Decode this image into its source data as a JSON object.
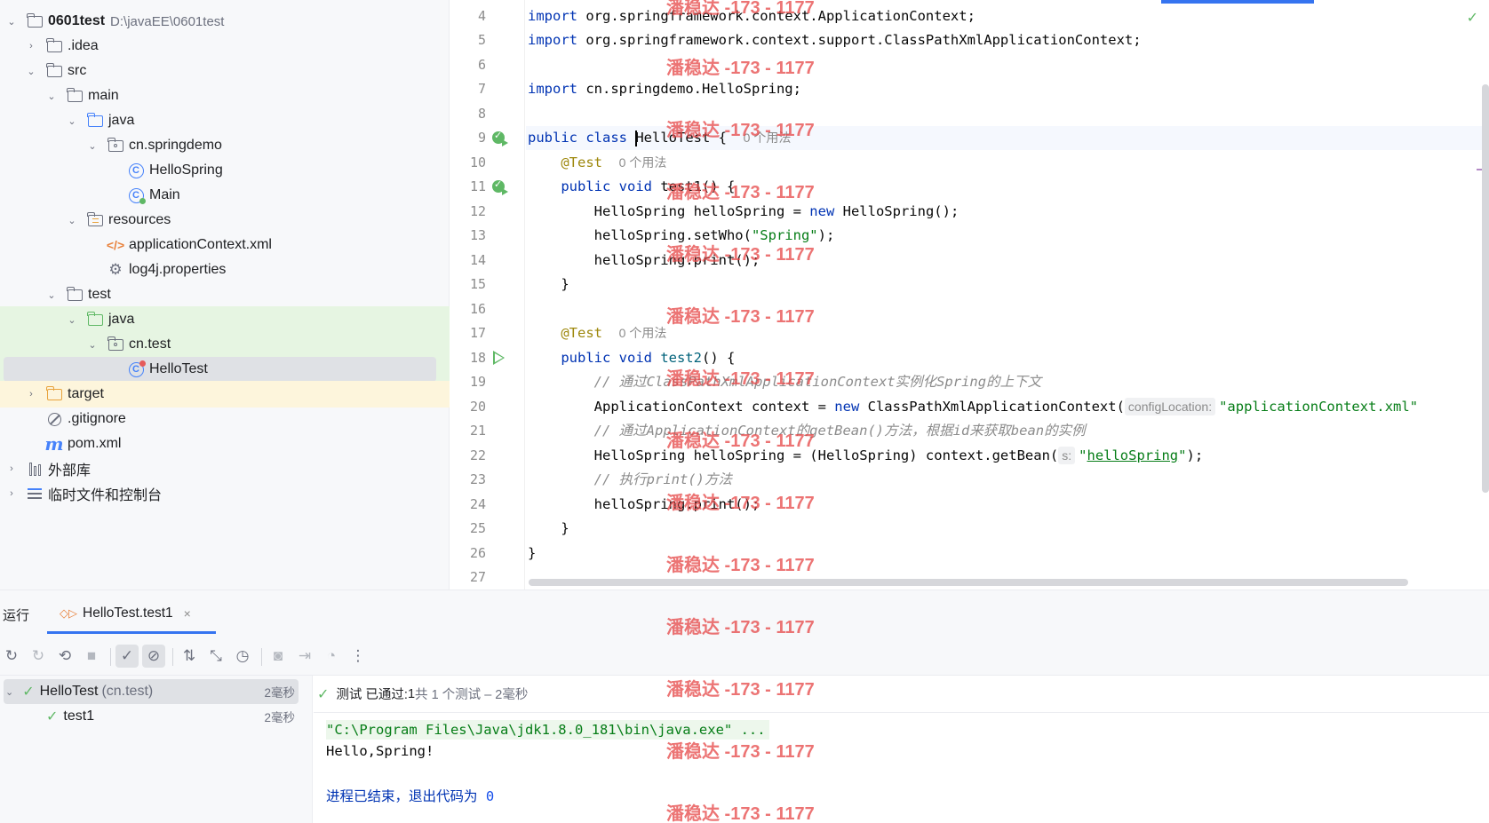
{
  "project_tree": {
    "items": [
      {
        "label": "0601test",
        "path": "D:\\javaEE\\0601test"
      },
      {
        "label": ".idea"
      },
      {
        "label": "src"
      },
      {
        "label": "main"
      },
      {
        "label": "java"
      },
      {
        "label": "cn.springdemo"
      },
      {
        "label": "HelloSpring"
      },
      {
        "label": "Main"
      },
      {
        "label": "resources"
      },
      {
        "label": "applicationContext.xml"
      },
      {
        "label": "log4j.properties"
      },
      {
        "label": "test"
      },
      {
        "label": "java"
      },
      {
        "label": "cn.test"
      },
      {
        "label": "HelloTest"
      },
      {
        "label": "target"
      },
      {
        "label": ".gitignore"
      },
      {
        "label": "pom.xml"
      },
      {
        "label": "外部库"
      },
      {
        "label": "临时文件和控制台"
      }
    ]
  },
  "editor": {
    "line_numbers": [
      "4",
      "5",
      "6",
      "7",
      "8",
      "9",
      "10",
      "11",
      "12",
      "13",
      "14",
      "15",
      "16",
      "17",
      "18",
      "19",
      "20",
      "21",
      "22",
      "23",
      "24",
      "25",
      "26",
      "27"
    ],
    "usage_hint": "0 个用法",
    "param_hint_config": "configLocation:",
    "param_hint_s": "s:",
    "code": {
      "l4_import": "import",
      "l4_rest": " org.springframework.context.ApplicationContext;",
      "l5_import": "import",
      "l5_rest": " org.springframework.context.support.ClassPathXmlApplicationContext;",
      "l7_import": "import",
      "l7_rest": " cn.springdemo.HelloSpring;",
      "l9_kw": "public class ",
      "l9_name": "HelloTest",
      "l9_rest": " {  ",
      "l10_ann": "@Test",
      "l11_kw": "public void ",
      "l11_rest": "test1() {",
      "l12_a": "HelloSpring helloSpring = ",
      "l12_kw": "new",
      "l12_b": " HelloSpring();",
      "l13_a": "helloSpring.setWho(",
      "l13_str": "\"Spring\"",
      "l13_b": ");",
      "l14": "helloSpring.print();",
      "l15": "}",
      "l17_ann": "@Test",
      "l18_kw": "public void ",
      "l18_meth": "test2",
      "l18_rest": "() {",
      "l19_cmt": "// 通过ClassPathXmlApplicationContext实例化Spring的上下文",
      "l20_a": "ApplicationContext context = ",
      "l20_kw": "new",
      "l20_b": " ClassPathXmlApplicationContext(",
      "l20_str": "\"applicationContext.xml\"",
      "l21_cmt": "// 通过ApplicationContext的getBean()方法，根据id来获取bean的实例",
      "l22_a": "HelloSpring helloSpring = (HelloSpring) context.getBean(",
      "l22_q1": "\"",
      "l22_str": "helloSpring",
      "l22_q2": "\"",
      "l22_b": ");",
      "l23_cmt": "// 执行print()方法",
      "l24": "helloSpring.print();",
      "l25": "}",
      "l26": "}"
    }
  },
  "run_panel": {
    "title": "运行",
    "tab_label": "HelloTest.test1",
    "tab_close": "×",
    "status_text": "测试 已通过: ",
    "status_count": "1",
    "status_detail": "共 1 个测试 – 2毫秒",
    "test_tree": [
      {
        "label": "HelloTest",
        "pkg": "(cn.test)",
        "time": "2毫秒"
      },
      {
        "label": "test1",
        "time": "2毫秒"
      }
    ],
    "console": {
      "cmd": "\"C:\\Program Files\\Java\\jdk1.8.0_181\\bin\\java.exe\" ...",
      "output": "Hello,Spring!",
      "exit_text": "进程已结束，退出代码为 ",
      "exit_code": "0"
    }
  },
  "watermark": "潘稳达 -173 - 1177",
  "colors": {
    "keyword": "#0033b3",
    "string": "#067d17",
    "annotation": "#9e880d",
    "comment": "#8c8c8c",
    "success": "#5fb865",
    "accent": "#3574f0",
    "watermark": "#e64646"
  }
}
